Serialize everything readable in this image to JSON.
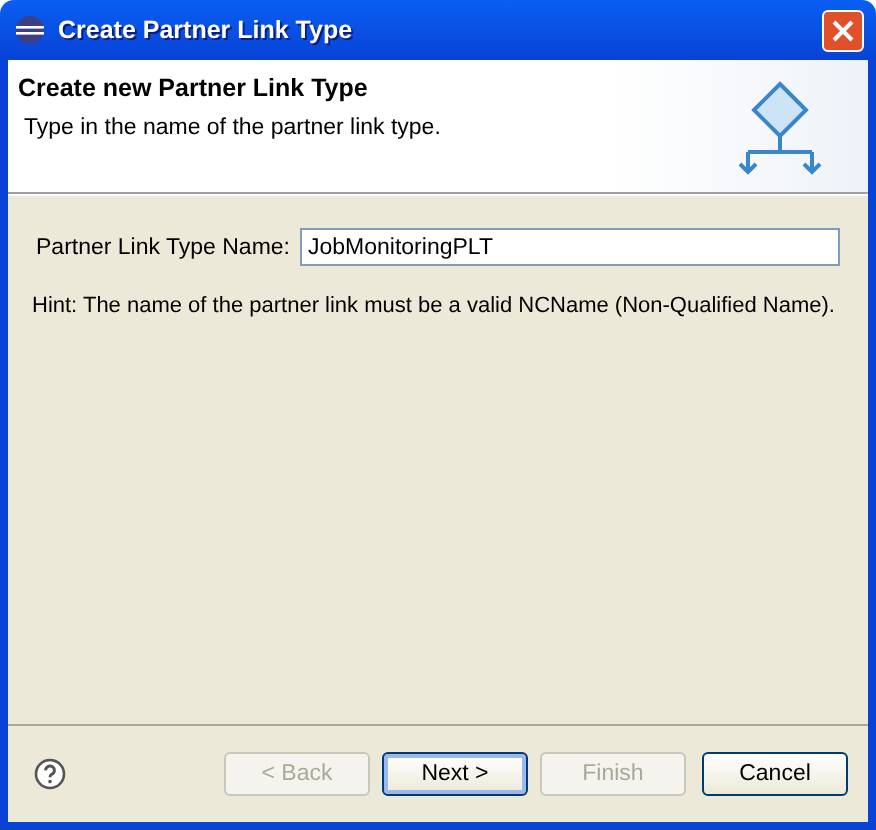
{
  "window": {
    "title": "Create Partner Link Type"
  },
  "header": {
    "title": "Create new Partner Link Type",
    "description": "Type in the name of the partner link type."
  },
  "field": {
    "label": "Partner Link Type Name:",
    "value": "JobMonitoringPLT"
  },
  "hint": "Hint: The name of the partner link must be a valid NCName (Non-Qualified Name).",
  "buttons": [
    {
      "label": "< Back",
      "disabled": true,
      "default": false
    },
    {
      "label": "Next >",
      "disabled": false,
      "default": true
    },
    {
      "label": "Finish",
      "disabled": true,
      "default": false
    },
    {
      "label": "Cancel",
      "disabled": false,
      "default": false
    }
  ]
}
